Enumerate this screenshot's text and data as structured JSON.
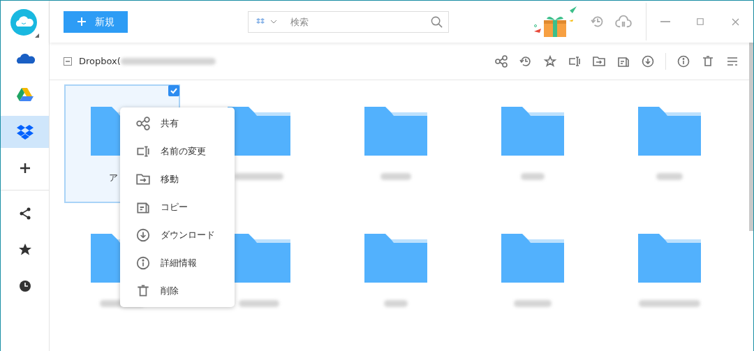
{
  "new_button": {
    "label": "新規"
  },
  "search": {
    "placeholder": "検索"
  },
  "sidebar": {
    "items": [
      {
        "selected": false
      },
      {
        "selected": false
      },
      {
        "selected": true
      },
      {
        "selected": false
      },
      {
        "selected": false
      },
      {
        "selected": false
      },
      {
        "selected": false
      }
    ]
  },
  "path": {
    "label": "Dropbox(",
    "partially_checked": true
  },
  "folders": [
    {
      "name": "ア",
      "selected": true
    },
    {
      "selected": false
    },
    {
      "selected": false
    },
    {
      "selected": false
    },
    {
      "selected": false
    },
    {
      "selected": false
    },
    {
      "selected": false
    },
    {
      "selected": false
    },
    {
      "selected": false
    },
    {
      "selected": false
    }
  ],
  "context_menu": [
    {
      "label": "共有"
    },
    {
      "label": "名前の変更"
    },
    {
      "label": "移動"
    },
    {
      "label": "コピー"
    },
    {
      "label": "ダウンロード"
    },
    {
      "label": "詳細情報"
    },
    {
      "label": "削除"
    }
  ]
}
